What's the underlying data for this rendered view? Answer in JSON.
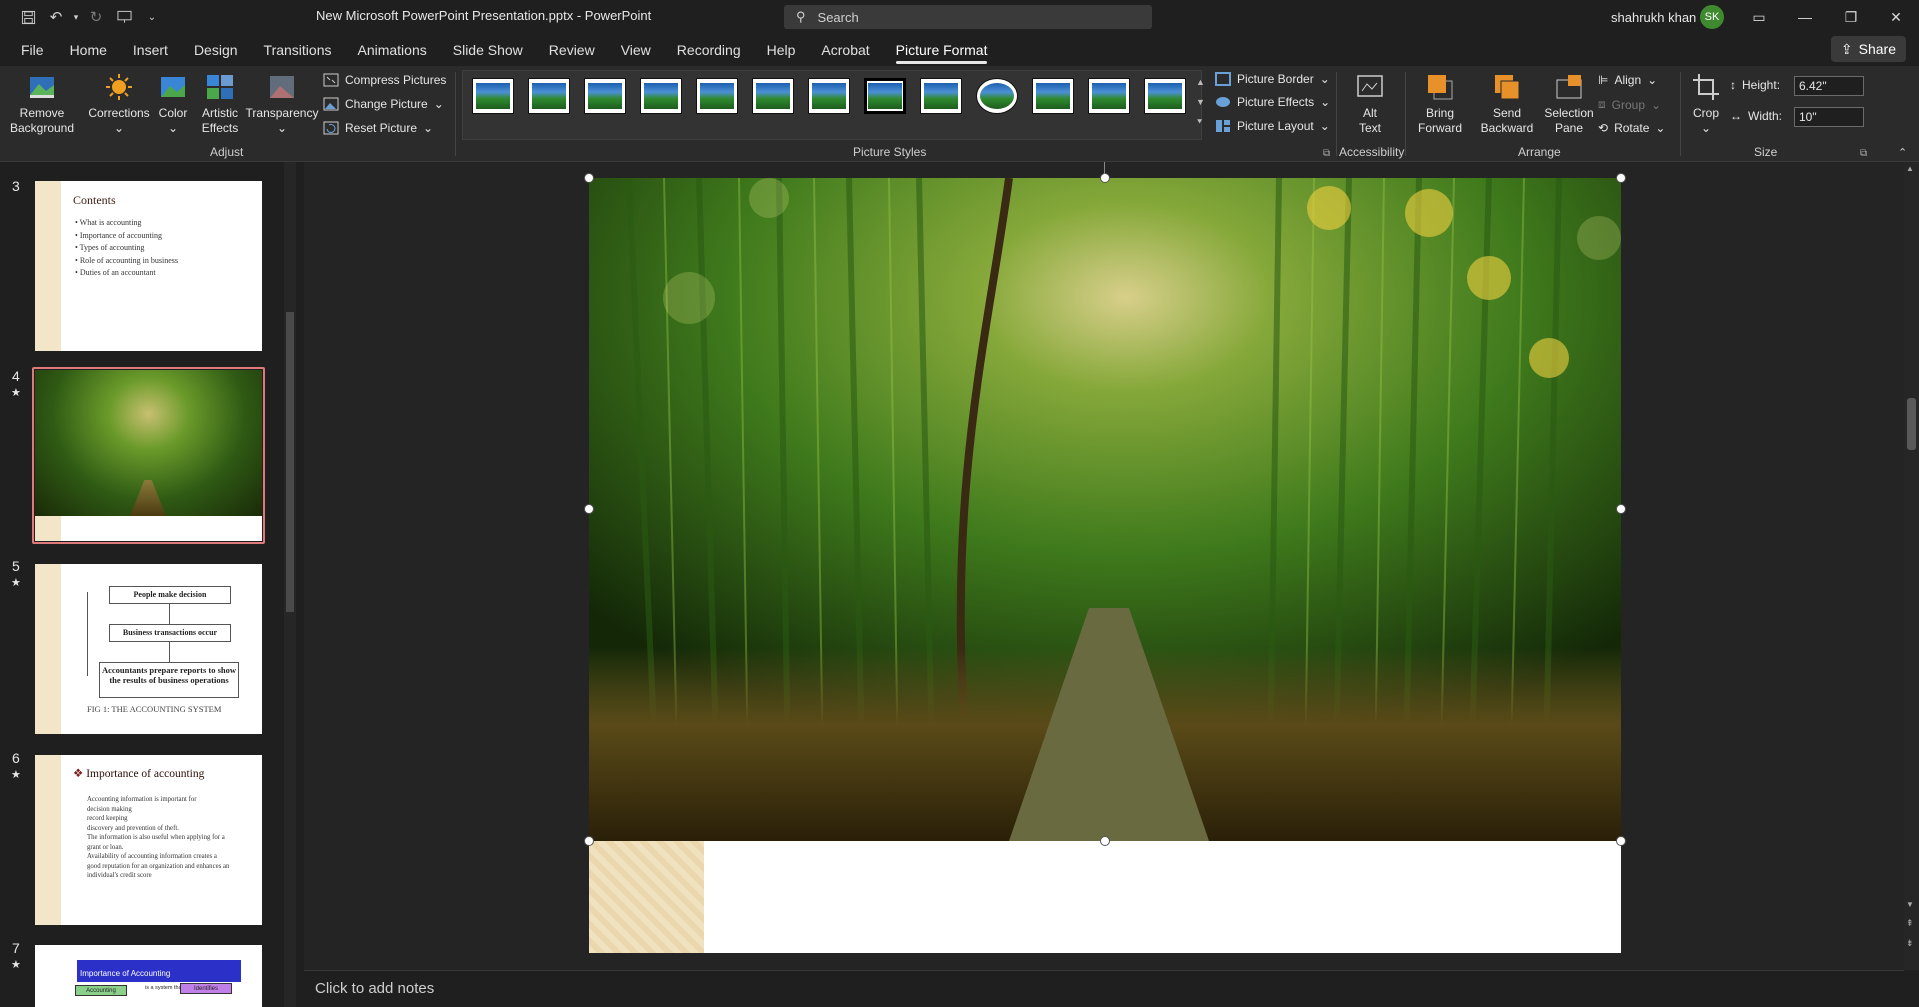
{
  "titlebar": {
    "doc_title": "New Microsoft PowerPoint  Presentation.pptx  -  PowerPoint",
    "search_placeholder": "Search",
    "user_name": "shahrukh khan",
    "avatar_initials": "SK"
  },
  "tabs": [
    "File",
    "Home",
    "Insert",
    "Design",
    "Transitions",
    "Animations",
    "Slide Show",
    "Review",
    "View",
    "Recording",
    "Help",
    "Acrobat",
    "Picture Format"
  ],
  "active_tab": "Picture Format",
  "share_label": "Share",
  "ribbon": {
    "remove_bg": [
      "Remove",
      "Background"
    ],
    "corrections": "Corrections",
    "color": "Color",
    "artistic": [
      "Artistic",
      "Effects"
    ],
    "transparency": "Transparency",
    "compress": "Compress Pictures",
    "change": "Change Picture",
    "reset": "Reset Picture",
    "adjust_label": "Adjust",
    "styles_label": "Picture Styles",
    "border": "Picture Border",
    "effects": "Picture Effects",
    "layout": "Picture Layout",
    "alt_text": [
      "Alt",
      "Text"
    ],
    "accessibility_label": "Accessibility",
    "bring_forward": [
      "Bring",
      "Forward"
    ],
    "send_backward": [
      "Send",
      "Backward"
    ],
    "selection_pane": [
      "Selection",
      "Pane"
    ],
    "align": "Align",
    "group": "Group",
    "rotate": "Rotate",
    "arrange_label": "Arrange",
    "crop": "Crop",
    "height_label": "Height:",
    "height_value": "6.42\"",
    "width_label": "Width:",
    "width_value": "10\"",
    "size_label": "Size"
  },
  "slides": [
    {
      "num": "3",
      "title": "Contents",
      "bullets": [
        "What is accounting",
        "Importance of accounting",
        "Types of accounting",
        "Role of accounting in business",
        "Duties of an accountant"
      ]
    },
    {
      "num": "4"
    },
    {
      "num": "5",
      "boxes": [
        "People make decision",
        "Business transactions occur",
        "Accountants prepare reports to show the results of business operations"
      ],
      "caption": "FIG 1: THE ACCOUNTING SYSTEM"
    },
    {
      "num": "6",
      "title": "Importance of accounting",
      "lines": [
        "Accounting information is important for",
        "decision making",
        "record keeping",
        "discovery and prevention of theft.",
        "The information is also useful when applying for a",
        "grant or loan.",
        "Availability of accounting information creates a",
        "good reputation for an organization and enhances an",
        "individual's credit score"
      ]
    },
    {
      "num": "7",
      "title": "Importance of Accounting",
      "tags": [
        "Accounting",
        "is a system that",
        "Identifies"
      ]
    }
  ],
  "notes_placeholder": "Click to add notes",
  "colors": {
    "accent_thumb_border": "#e07a7a",
    "bring_forward": "#e8902a",
    "avatar": "#3f8a2f"
  }
}
